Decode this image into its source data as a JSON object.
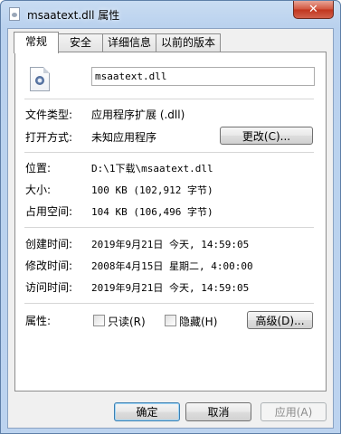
{
  "window": {
    "title": "msaatext.dll 属性",
    "close_glyph": "✕"
  },
  "tabs": [
    {
      "label": "常规",
      "active": true
    },
    {
      "label": "安全",
      "active": false
    },
    {
      "label": "详细信息",
      "active": false
    },
    {
      "label": "以前的版本",
      "active": false
    }
  ],
  "general": {
    "file_name": "msaatext.dll",
    "file_type": {
      "label": "文件类型:",
      "value": "应用程序扩展 (.dll)"
    },
    "opens_with": {
      "label": "打开方式:",
      "value": "未知应用程序",
      "button": "更改(C)..."
    },
    "location": {
      "label": "位置:",
      "value": "D:\\1下载\\msaatext.dll"
    },
    "size": {
      "label": "大小:",
      "value": "100 KB (102,912 字节)"
    },
    "size_on_disk": {
      "label": "占用空间:",
      "value": "104 KB (106,496 字节)"
    },
    "created": {
      "label": "创建时间:",
      "value": "2019年9月21日 今天, 14:59:05"
    },
    "modified": {
      "label": "修改时间:",
      "value": "2008年4月15日 星期二, 4:00:00"
    },
    "accessed": {
      "label": "访问时间:",
      "value": "2019年9月21日 今天, 14:59:05"
    },
    "attributes": {
      "label": "属性:",
      "readonly": "只读(R)",
      "hidden": "隐藏(H)",
      "advanced": "高级(D)..."
    }
  },
  "footer": {
    "ok": "确定",
    "cancel": "取消",
    "apply": "应用(A)"
  }
}
